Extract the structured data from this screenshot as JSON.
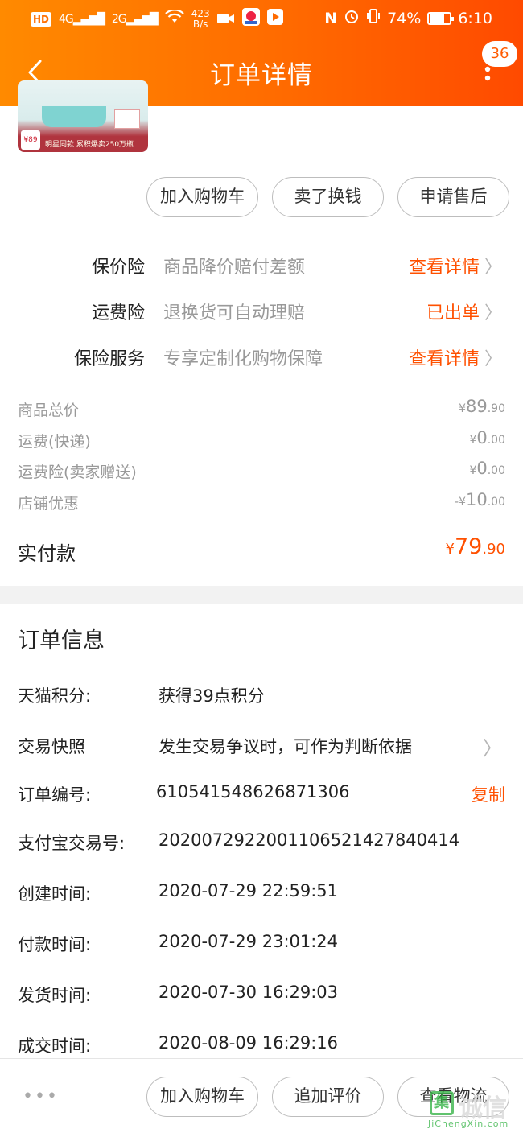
{
  "status_bar": {
    "hd_label": "HD",
    "net_1": "4G",
    "net_2": "2G",
    "speed_value": "423",
    "speed_unit": "B/s",
    "nfc": "N",
    "battery_pct": "74%",
    "battery_level": 0.74,
    "time": "6:10"
  },
  "header": {
    "title": "订单详情",
    "badge_count": "36"
  },
  "product_thumb": {
    "tag": "¥89",
    "caption": "明星同款 累积爆卖250万瓶"
  },
  "top_actions": {
    "add_cart": "加入购物车",
    "sell": "卖了换钱",
    "after_sale": "申请售后"
  },
  "insurance": [
    {
      "name": "保价险",
      "desc": "商品降价赔付差额",
      "link": "查看详情"
    },
    {
      "name": "运费险",
      "desc": "退换货可自动理赔",
      "link": "已出单"
    },
    {
      "name": "保险服务",
      "desc": "专享定制化购物保障",
      "link": "查看详情"
    }
  ],
  "fees": [
    {
      "label": "商品总价",
      "sign": "",
      "int": "89",
      "dec": ".90"
    },
    {
      "label": "运费(快递)",
      "sign": "",
      "int": "0",
      "dec": ".00"
    },
    {
      "label": "运费险(卖家赠送)",
      "sign": "",
      "int": "0",
      "dec": ".00"
    },
    {
      "label": "店铺优惠",
      "sign": "-",
      "int": "10",
      "dec": ".00"
    }
  ],
  "currency": "¥",
  "paid": {
    "label": "实付款",
    "int": "79",
    "dec": ".90"
  },
  "order_info": {
    "title": "订单信息",
    "rows": [
      {
        "label": "天猫积分:",
        "value": "获得39点积分"
      },
      {
        "label": "交易快照",
        "value": "发生交易争议时，可作为判断依据"
      },
      {
        "label": "订单编号:",
        "value": "610541548626871306",
        "action": "复制"
      },
      {
        "label": "支付宝交易号:",
        "value": "2020072922001106521427840414"
      },
      {
        "label": "创建时间:",
        "value": "2020-07-29 22:59:51"
      },
      {
        "label": "付款时间:",
        "value": "2020-07-29 23:01:24"
      },
      {
        "label": "发货时间:",
        "value": "2020-07-30 16:29:03"
      },
      {
        "label": "成交时间:",
        "value": "2020-08-09 16:29:16"
      }
    ]
  },
  "bottom_actions": {
    "dots": "•••",
    "add_cart": "加入购物车",
    "review": "追加评价",
    "logistics": "查看物流"
  },
  "watermark": {
    "logo": "集",
    "cn": "诚信",
    "en": "JiChengXin.com"
  }
}
